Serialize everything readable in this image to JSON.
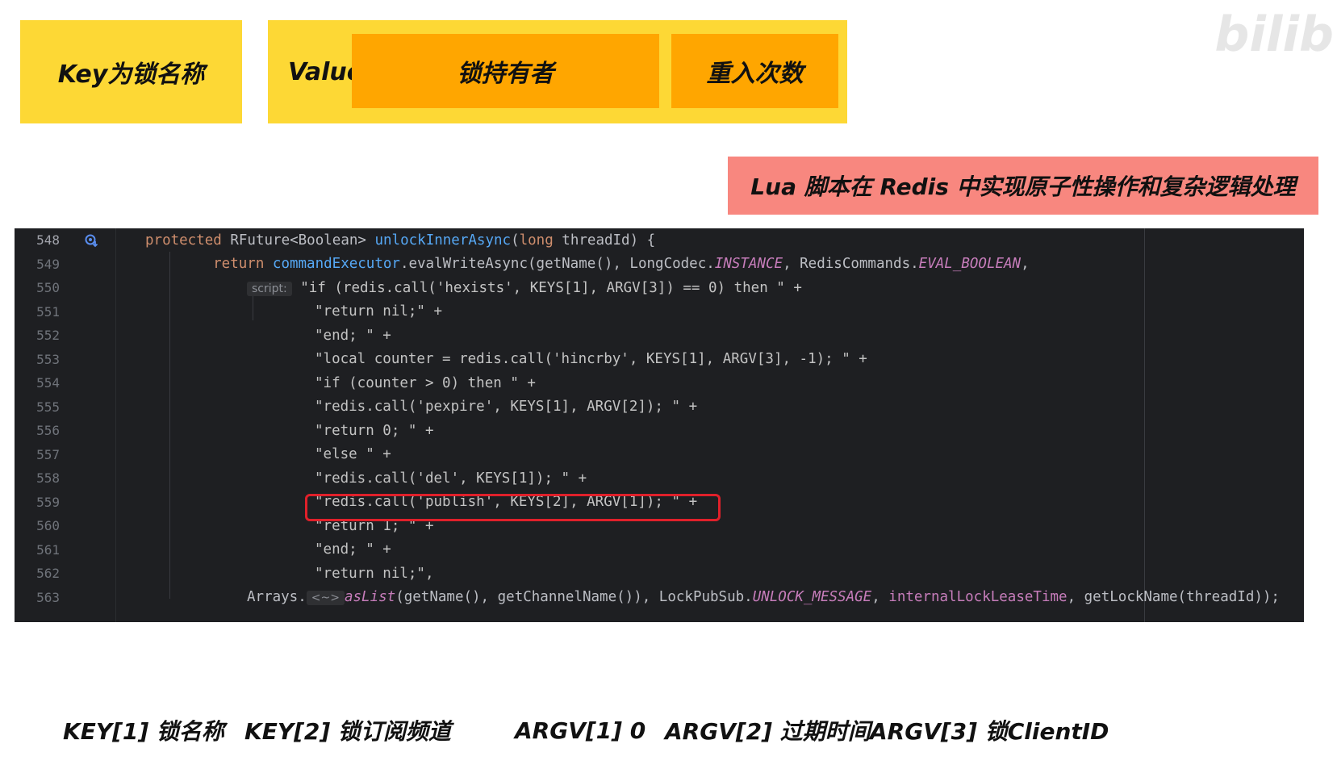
{
  "header": {
    "key_label": "Key为锁名称",
    "value_label": "Value",
    "holder_label": "锁持有者",
    "reentry_label": "重入次数"
  },
  "lua_banner": "Lua 脚本在 Redis 中实现原子性操作和复杂逻辑处理",
  "watermark": "bilib",
  "editor": {
    "lines": [
      {
        "num": "548",
        "parts": [
          [
            "kw",
            "protected "
          ],
          [
            "",
            "RFuture<Boolean> "
          ],
          [
            "fn",
            "unlockInnerAsync"
          ],
          [
            "",
            "("
          ],
          [
            "kw",
            "long "
          ],
          [
            "",
            "threadId) {"
          ]
        ]
      },
      {
        "num": "549",
        "parts": [
          [
            "kw",
            "    return "
          ],
          [
            "fn2",
            "commandExecutor"
          ],
          [
            "",
            ".evalWriteAsync(getName(), LongCodec."
          ],
          [
            "st",
            "INSTANCE"
          ],
          [
            "",
            ", RedisCommands."
          ],
          [
            "st",
            "EVAL_BOOLEAN"
          ],
          [
            "",
            ","
          ]
        ]
      },
      {
        "num": "550",
        "parts": [
          [
            "hint",
            "script:"
          ],
          [
            "str",
            " \"if (redis.call('hexists', KEYS[1], ARGV[3]) == 0) then \" +"
          ]
        ]
      },
      {
        "num": "551",
        "parts": [
          [
            "str",
            "\"return nil;\" +"
          ]
        ]
      },
      {
        "num": "552",
        "parts": [
          [
            "str",
            "\"end; \" +"
          ]
        ]
      },
      {
        "num": "553",
        "parts": [
          [
            "str",
            "\"local counter = redis.call('hincrby', KEYS[1], ARGV[3], -1); \" +"
          ]
        ]
      },
      {
        "num": "554",
        "parts": [
          [
            "str",
            "\"if (counter > 0) then \" +"
          ]
        ]
      },
      {
        "num": "555",
        "parts": [
          [
            "str",
            "\"redis.call('pexpire', KEYS[1], ARGV[2]); \" +"
          ]
        ]
      },
      {
        "num": "556",
        "parts": [
          [
            "str",
            "\"return 0; \" +"
          ]
        ]
      },
      {
        "num": "557",
        "parts": [
          [
            "str",
            "\"else \" +"
          ]
        ]
      },
      {
        "num": "558",
        "parts": [
          [
            "str",
            "\"redis.call('del', KEYS[1]); \" +"
          ]
        ]
      },
      {
        "num": "559",
        "parts": [
          [
            "str",
            "\"redis.call('publish', KEYS[2], ARGV[1]); \" +"
          ]
        ]
      },
      {
        "num": "560",
        "parts": [
          [
            "str",
            "\"return 1; \" +"
          ]
        ]
      },
      {
        "num": "561",
        "parts": [
          [
            "str",
            "\"end; \" +"
          ]
        ]
      },
      {
        "num": "562",
        "parts": [
          [
            "str",
            "\"return nil;\","
          ]
        ]
      },
      {
        "num": "563",
        "parts": [
          [
            "",
            "Arrays."
          ],
          [
            "hint",
            "<~>"
          ],
          [
            "st",
            "asList"
          ],
          [
            "",
            "(getName(), getChannelName()), LockPubSub."
          ],
          [
            "st",
            "UNLOCK_MESSAGE"
          ],
          [
            "",
            ", "
          ],
          [
            "fld",
            "internalLockLeaseTime"
          ],
          [
            "",
            ", getLockName(threadId));"
          ]
        ]
      }
    ],
    "indents": [
      172,
      214,
      298,
      382,
      382,
      382,
      382,
      382,
      382,
      382,
      382,
      382,
      382,
      382,
      382,
      298
    ]
  },
  "legend": [
    "KEY[1] 锁名称",
    "KEY[2] 锁订阅频道",
    "ARGV[1] 0",
    "ARGV[2] 过期时间",
    "ARGV[3] 锁ClientID"
  ],
  "colors": {
    "yellow": "#fdd835",
    "orange": "#ffa600",
    "salmon": "#f8877f",
    "editor_bg": "#1e1f22",
    "highlight": "#e0202a"
  }
}
